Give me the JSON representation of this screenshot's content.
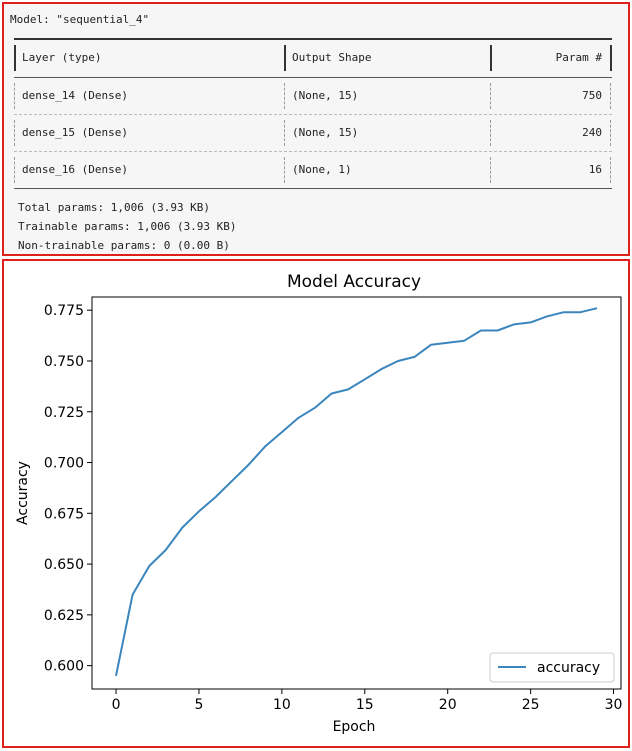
{
  "summary": {
    "model_label": "Model: \"sequential_4\"",
    "headers": {
      "layer": "Layer (type)",
      "output": "Output Shape",
      "params": "Param #"
    },
    "rows": [
      {
        "layer": "dense_14 (Dense)",
        "output": "(None, 15)",
        "params": "750"
      },
      {
        "layer": "dense_15 (Dense)",
        "output": "(None, 15)",
        "params": "240"
      },
      {
        "layer": "dense_16 (Dense)",
        "output": "(None, 1)",
        "params": "16"
      }
    ],
    "total_params": "Total params: 1,006 (3.93 KB)",
    "trainable_params": "Trainable params: 1,006 (3.93 KB)",
    "non_trainable_params": "Non-trainable params: 0 (0.00 B)"
  },
  "chart_data": {
    "type": "line",
    "title": "Model Accuracy",
    "xlabel": "Epoch",
    "ylabel": "Accuracy",
    "xlim": [
      -1.45,
      30.45
    ],
    "ylim": [
      0.5885,
      0.7815
    ],
    "xticks": [
      0,
      5,
      10,
      15,
      20,
      25,
      30
    ],
    "yticks": [
      0.6,
      0.625,
      0.65,
      0.675,
      0.7,
      0.725,
      0.75,
      0.775
    ],
    "ytick_labels": [
      "0.600",
      "0.625",
      "0.650",
      "0.675",
      "0.700",
      "0.725",
      "0.750",
      "0.775"
    ],
    "grid": false,
    "legend": "lower right",
    "series": [
      {
        "name": "accuracy",
        "color": "#3a86bd",
        "x": [
          0,
          1,
          2,
          3,
          4,
          5,
          6,
          7,
          8,
          9,
          10,
          11,
          12,
          13,
          14,
          15,
          16,
          17,
          18,
          19,
          20,
          21,
          22,
          23,
          24,
          25,
          26,
          27,
          28,
          29
        ],
        "y": [
          0.595,
          0.635,
          0.649,
          0.657,
          0.668,
          0.676,
          0.683,
          0.691,
          0.699,
          0.708,
          0.715,
          0.722,
          0.727,
          0.734,
          0.736,
          0.741,
          0.746,
          0.75,
          0.752,
          0.758,
          0.759,
          0.76,
          0.765,
          0.765,
          0.768,
          0.769,
          0.772,
          0.774,
          0.774,
          0.776
        ]
      }
    ]
  }
}
